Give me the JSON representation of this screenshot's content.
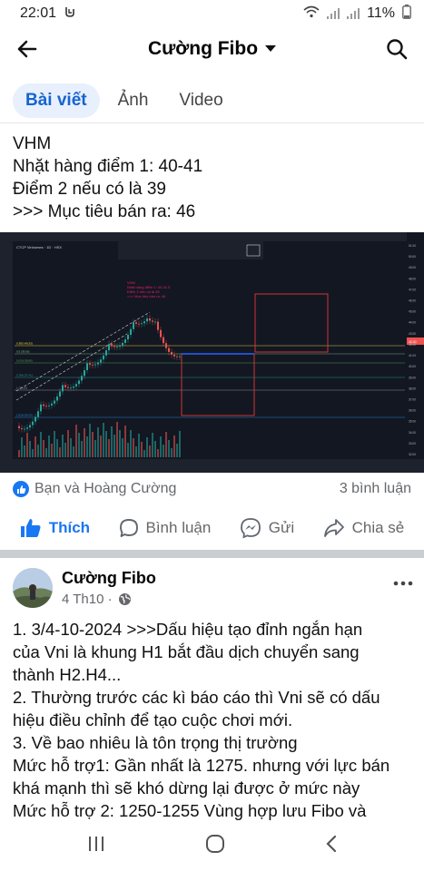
{
  "status": {
    "time": "22:01",
    "battery": "11%"
  },
  "header": {
    "title": "Cường Fibo"
  },
  "tabs": [
    {
      "label": "Bài viết"
    },
    {
      "label": "Ảnh"
    },
    {
      "label": "Video"
    }
  ],
  "post1": {
    "lines": [
      "VHM",
      "Nhặt hàng điểm 1: 40-41",
      "Điểm 2 nếu có là 39",
      ">>> Mục tiêu bán ra: 46"
    ],
    "reactions_text": "Bạn và Hoàng Cường",
    "comments_text": "3 bình luận",
    "actions": {
      "like": "Thích",
      "comment": "Bình luận",
      "send": "Gửi",
      "share": "Chia sẻ"
    }
  },
  "chart_data": {
    "type": "candlestick",
    "header_text": "CTCP Vinhomes · 1D · HSX",
    "annotation": [
      "VHM",
      "Nhặt hàng điểm 1: 40-41.5",
      "Điểm 2 nếu có là 39",
      ">>> Mục tiêu bán ra: 46"
    ],
    "fib_labels": [
      "0.382 (40.53)",
      "0.5 (39.56)",
      "0.618 (38.85)",
      "0.786 (37.41)",
      "1 (35.00)",
      "1.618 (30.03)"
    ],
    "y_ticks": [
      "51.00",
      "50.00",
      "49.00",
      "48.00",
      "47.00",
      "46.00",
      "45.00",
      "44.00",
      "43.00",
      "42.00",
      "41.00",
      "40.00",
      "39.00",
      "38.00",
      "37.00",
      "36.00",
      "35.00",
      "34.00",
      "33.00",
      "32.00"
    ],
    "last_price": "40.30",
    "ylim": [
      32,
      51
    ],
    "colors": {
      "up": "#26a69a",
      "down": "#ef5350",
      "background": "#131722"
    }
  },
  "post2": {
    "author": "Cường Fibo",
    "date": "4 Th10 ·",
    "lines": [
      "1. 3/4-10-2024 >>>Dấu hiệu tạo đỉnh ngắn hạn",
      "của Vni là khung H1 bắt đầu dịch chuyển sang",
      "thành H2.H4...",
      "2. Thường trước các kì báo cáo thì Vni sẽ có dấu",
      "hiệu điều chỉnh để tạo cuộc chơi mới.",
      "3. Về bao nhiêu là tôn trọng thị trường",
      "Mức hỗ trợ1:  Gần nhất là 1275. nhưng với lực bán",
      "khá mạnh thì sẽ khó dừng lại được ở mức này",
      "Mức hỗ trợ 2: 1250-1255  Vùng hợp lưu Fibo và"
    ]
  }
}
